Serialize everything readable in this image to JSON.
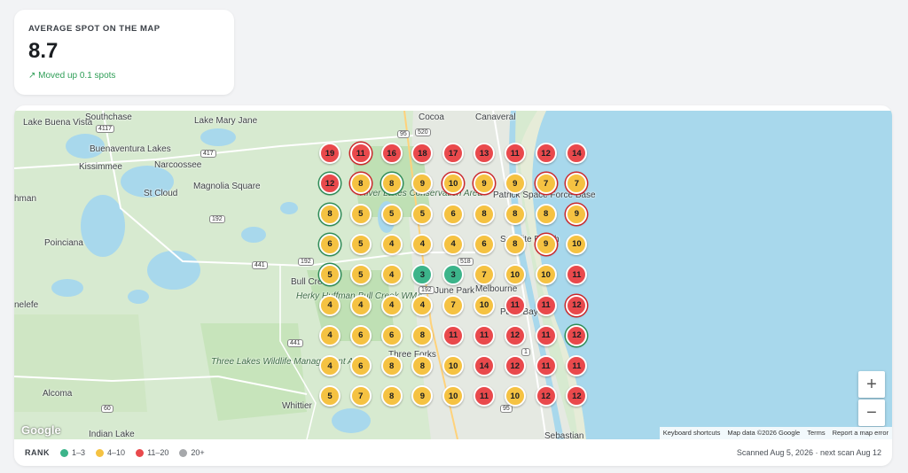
{
  "stat": {
    "label": "AVERAGE SPOT ON THE MAP",
    "value": "8.7",
    "delta": "↗ Moved up 0.1 spots"
  },
  "map": {
    "places": [
      "Lake Buena Vista",
      "Southchase",
      "Lake Mary Jane",
      "Cocoa",
      "Canaveral",
      "Buenaventura Lakes",
      "Kissimmee",
      "Narcoossee",
      "St Cloud",
      "Magnolia Square",
      "Poinciana",
      "Bull Creek",
      "Herky Huffman Bull Creek WMA",
      "Three Lakes Wildlife Management Area",
      "River Lakes Conservation Area",
      "Patrick Space Force Base",
      "Satellite Beach",
      "Melbourne",
      "June Park",
      "Palm Bay",
      "Three Forks",
      "Whittier",
      "Alcoma",
      "Indian Lake",
      "Sebastian",
      "nelefe",
      "hman"
    ],
    "shields": [
      "4117",
      "417",
      "192",
      "441",
      "192",
      "518",
      "95",
      "520",
      "1",
      "60",
      "441",
      "192",
      "95"
    ],
    "zoom_in": "+",
    "zoom_out": "−",
    "google": "Google",
    "attribution": [
      "Keyboard shortcuts",
      "Map data ©2026 Google",
      "Terms",
      "Report a map error"
    ]
  },
  "grid": [
    [
      19,
      11,
      16,
      18,
      17,
      13,
      11,
      12,
      14
    ],
    [
      12,
      8,
      8,
      9,
      10,
      9,
      9,
      7,
      7
    ],
    [
      8,
      5,
      5,
      5,
      6,
      8,
      8,
      8,
      9
    ],
    [
      6,
      5,
      4,
      4,
      4,
      6,
      8,
      9,
      10
    ],
    [
      5,
      5,
      4,
      3,
      3,
      7,
      10,
      10,
      11
    ],
    [
      4,
      4,
      4,
      4,
      7,
      10,
      11,
      11,
      12
    ],
    [
      4,
      6,
      6,
      8,
      11,
      11,
      12,
      11,
      12
    ],
    [
      4,
      6,
      8,
      8,
      10,
      14,
      12,
      11,
      11
    ],
    [
      5,
      7,
      8,
      9,
      10,
      11,
      10,
      12,
      12
    ]
  ],
  "rings": [
    [
      1,
      0,
      "red"
    ],
    [
      1,
      1,
      "red"
    ],
    [
      2,
      1,
      "green"
    ],
    [
      4,
      1,
      "red"
    ],
    [
      5,
      1,
      "red"
    ],
    [
      8,
      1,
      "green"
    ],
    [
      0,
      1,
      "green"
    ],
    [
      4,
      1,
      "red"
    ],
    [
      7,
      1,
      "red"
    ],
    [
      8,
      1,
      "red"
    ],
    [
      0,
      2,
      "green"
    ],
    [
      8,
      2,
      "red"
    ],
    [
      0,
      3,
      "green"
    ],
    [
      7,
      3,
      "red"
    ],
    [
      0,
      4,
      "green"
    ],
    [
      8,
      5,
      "red"
    ],
    [
      8,
      6,
      "green"
    ]
  ],
  "colors": {
    "green": "#3cb48a",
    "yellow": "#f5c242",
    "red": "#e9494c",
    "gray": "#a6a8ab",
    "water": "#a8d8ec"
  },
  "legend": {
    "title": "RANK",
    "items": [
      {
        "label": "1–3",
        "color": "#3cb48a"
      },
      {
        "label": "4–10",
        "color": "#f5c242"
      },
      {
        "label": "11–20",
        "color": "#e9494c"
      },
      {
        "label": "20+",
        "color": "#a6a8ab"
      }
    ],
    "scan": "Scanned Aug 5, 2026 · next scan Aug 12"
  }
}
